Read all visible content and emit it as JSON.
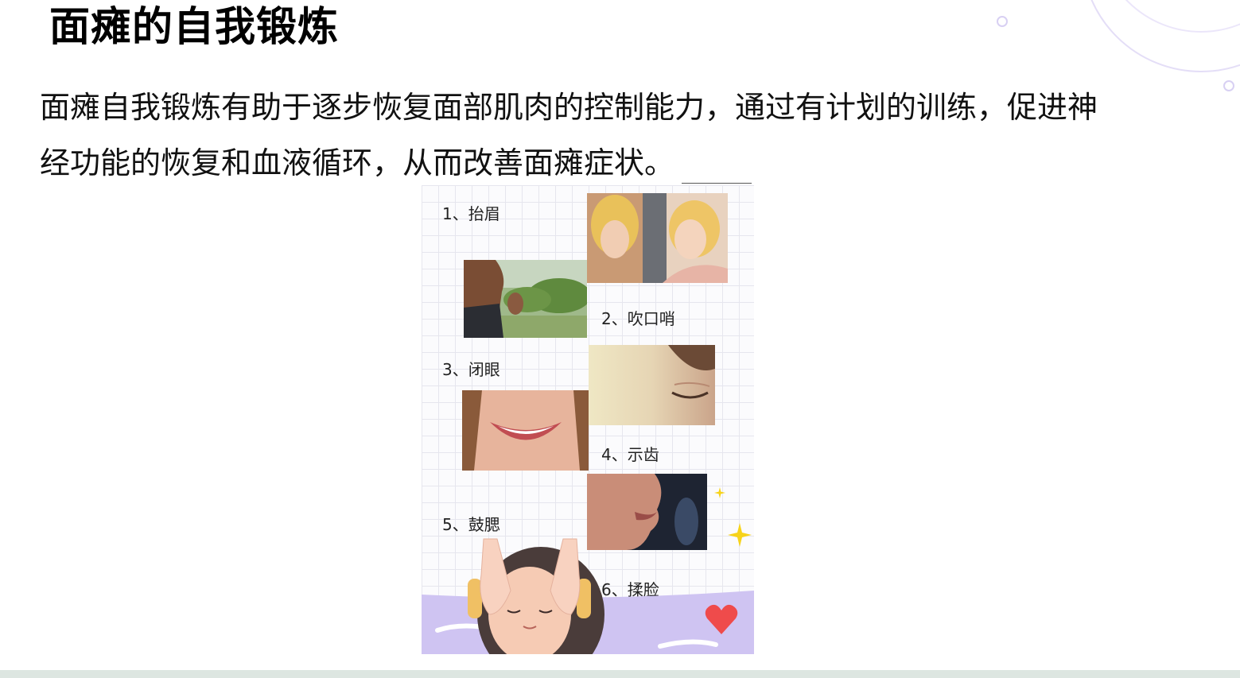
{
  "slide": {
    "title": "面瘫的自我锻炼",
    "description_lines": [
      "面瘫自我锻炼有助于逐步恢复面部肌肉的控制能力，通过有计划的训练，促进神",
      "经功能的恢复和血液循环，从而改善面瘫症状。"
    ]
  },
  "exercises": [
    {
      "label": "1、抬眉"
    },
    {
      "label": "2、吹口哨"
    },
    {
      "label": "3、闭眼"
    },
    {
      "label": "4、示齿"
    },
    {
      "label": "5、鼓腮"
    },
    {
      "label": "6、揉脸"
    }
  ],
  "colors": {
    "accent_lavender": "#cfc4f2",
    "grid_line": "#e6e6ee",
    "heart": "#ef4b4b",
    "sparkle": "#f7d31a"
  }
}
